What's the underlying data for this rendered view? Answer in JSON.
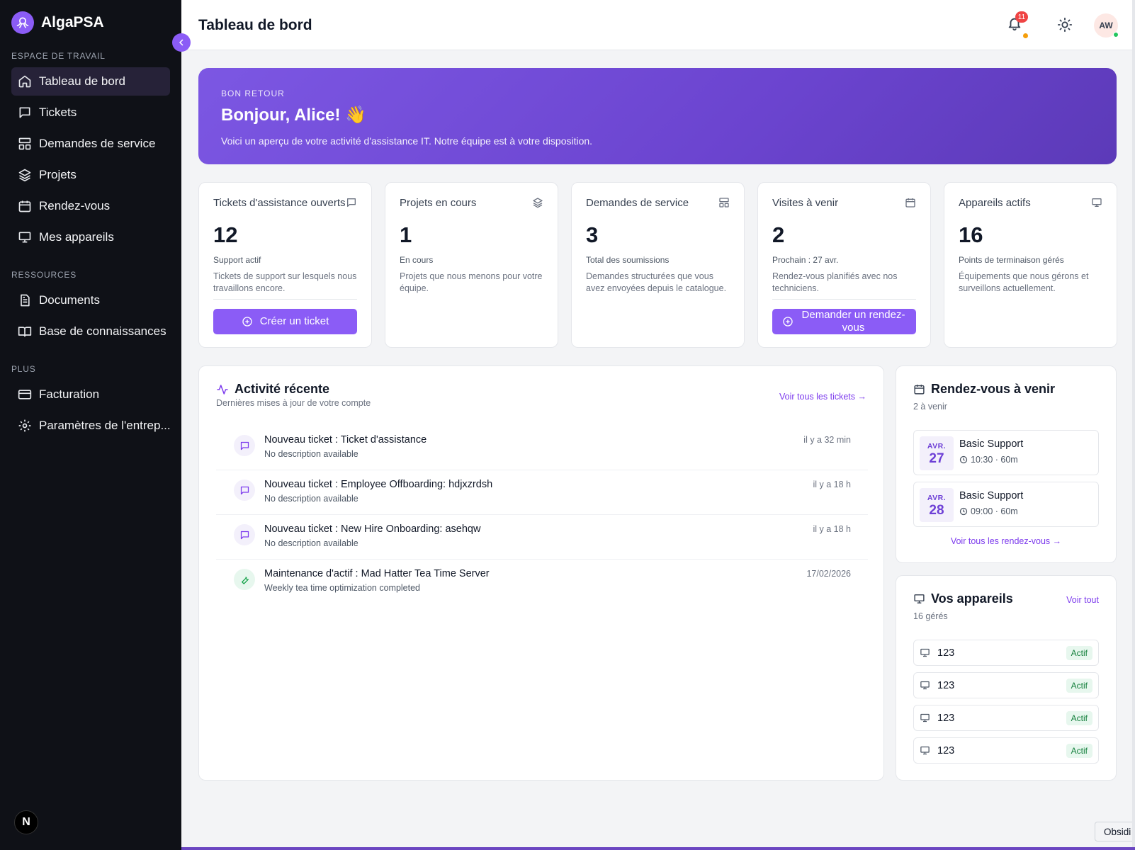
{
  "app": {
    "name": "AlgaPSA"
  },
  "sidebar": {
    "sections": [
      {
        "title": "ESPACE DE TRAVAIL",
        "items": [
          {
            "label": "Tableau de bord",
            "icon": "home-icon",
            "active": true
          },
          {
            "label": "Tickets",
            "icon": "message-icon"
          },
          {
            "label": "Demandes de service",
            "icon": "layout-icon"
          },
          {
            "label": "Projets",
            "icon": "layers-icon"
          },
          {
            "label": "Rendez-vous",
            "icon": "calendar-icon"
          },
          {
            "label": "Mes appareils",
            "icon": "monitor-icon"
          }
        ]
      },
      {
        "title": "RESSOURCES",
        "items": [
          {
            "label": "Documents",
            "icon": "document-icon"
          },
          {
            "label": "Base de connaissances",
            "icon": "book-icon"
          }
        ]
      },
      {
        "title": "PLUS",
        "items": [
          {
            "label": "Facturation",
            "icon": "credit-card-icon"
          },
          {
            "label": "Paramètres de l'entrep...",
            "icon": "gear-icon"
          }
        ]
      }
    ],
    "footer_badge": "N"
  },
  "header": {
    "title": "Tableau de bord",
    "notification_count": "11",
    "avatar_initials": "AW"
  },
  "hero": {
    "kicker": "BON RETOUR",
    "title": "Bonjour, Alice! 👋",
    "subtitle": "Voici un aperçu de votre activité d'assistance IT. Notre équipe est à votre disposition."
  },
  "stats": [
    {
      "title": "Tickets d'assistance ouverts",
      "value": "12",
      "sub": "Support actif",
      "desc": "Tickets de support sur lesquels nous travaillons encore.",
      "button": "Créer un ticket",
      "icon": "message-icon"
    },
    {
      "title": "Projets en cours",
      "value": "1",
      "sub": "En cours",
      "desc": "Projets que nous menons pour votre équipe.",
      "icon": "layers-icon"
    },
    {
      "title": "Demandes de service",
      "value": "3",
      "sub": "Total des soumissions",
      "desc": "Demandes structurées que vous avez envoyées depuis le catalogue.",
      "icon": "layout-icon"
    },
    {
      "title": "Visites à venir",
      "value": "2",
      "sub": "Prochain : 27 avr.",
      "desc": "Rendez-vous planifiés avec nos techniciens.",
      "button": "Demander un rendez-vous",
      "icon": "calendar-icon"
    },
    {
      "title": "Appareils actifs",
      "value": "16",
      "sub": "Points de terminaison gérés",
      "desc": "Équipements que nous gérons et surveillons actuellement.",
      "icon": "monitor-icon"
    }
  ],
  "activity": {
    "title": "Activité récente",
    "subtitle": "Dernières mises à jour de votre compte",
    "link": "Voir tous les tickets →",
    "items": [
      {
        "title": "Nouveau ticket : Ticket d'assistance",
        "desc": "No description available",
        "time": "il y a 32 min",
        "icon": "message-icon"
      },
      {
        "title": "Nouveau ticket : Employee Offboarding: hdjxzrdsh",
        "desc": "No description available",
        "time": "il y a 18 h",
        "icon": "message-icon"
      },
      {
        "title": "Nouveau ticket : New Hire Onboarding: asehqw",
        "desc": "No description available",
        "time": "il y a 18 h",
        "icon": "message-icon"
      },
      {
        "title": "Maintenance d'actif : Mad Hatter Tea Time Server",
        "desc": "Weekly tea time optimization completed",
        "time": "17/02/2026",
        "icon": "wrench-icon"
      }
    ]
  },
  "appointments": {
    "title": "Rendez-vous à venir",
    "count": "2 à venir",
    "items": [
      {
        "month": "AVR.",
        "day": "27",
        "title": "Basic Support",
        "time": "10:30 · 60m"
      },
      {
        "month": "AVR.",
        "day": "28",
        "title": "Basic Support",
        "time": "09:00 · 60m"
      }
    ],
    "link": "Voir tous les rendez-vous →"
  },
  "devices": {
    "title": "Vos appareils",
    "count": "16 gérés",
    "link": "Voir tout",
    "items": [
      {
        "name": "123",
        "status": "Actif"
      },
      {
        "name": "123",
        "status": "Actif"
      },
      {
        "name": "123",
        "status": "Actif"
      },
      {
        "name": "123",
        "status": "Actif"
      }
    ]
  },
  "corner_chip": "Obsidi",
  "colors": {
    "accent": "#8b5cf6",
    "sidebar_bg": "#0f1117",
    "success": "#15803d"
  }
}
